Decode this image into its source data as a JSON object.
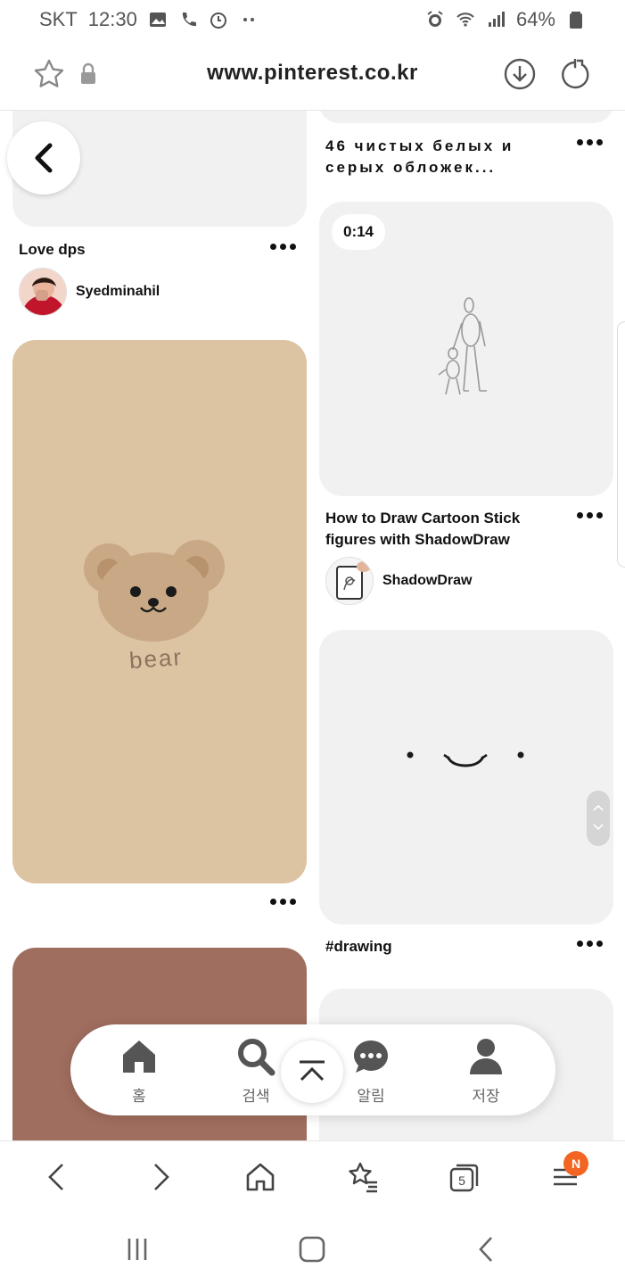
{
  "status_bar": {
    "carrier": "SKT",
    "time": "12:30",
    "battery": "64%"
  },
  "browser": {
    "url": "www.pinterest.co.kr"
  },
  "pins": {
    "left1": {
      "title": "Love dps",
      "author": "Syedminahil"
    },
    "right1": {
      "title_line1": "46 чистых белых и",
      "title_line2": "серых обложек..."
    },
    "right2": {
      "duration": "0:14",
      "title_line1": "How to Draw Cartoon Stick",
      "title_line2": "figures with ShadowDraw",
      "author": "ShadowDraw"
    },
    "left2": {
      "image_text": "bear"
    },
    "right3": {
      "title": "#drawing"
    }
  },
  "floating_nav": {
    "home": "홈",
    "search": "검색",
    "notifications": "알림",
    "saved": "저장"
  },
  "browser_tabs_count": "5",
  "menu_badge": "N",
  "colors": {
    "bear_bg": "#dcc3a1",
    "brown_card": "#a06e5f",
    "card_grey": "#f1f1f1",
    "badge_orange": "#f26522"
  }
}
